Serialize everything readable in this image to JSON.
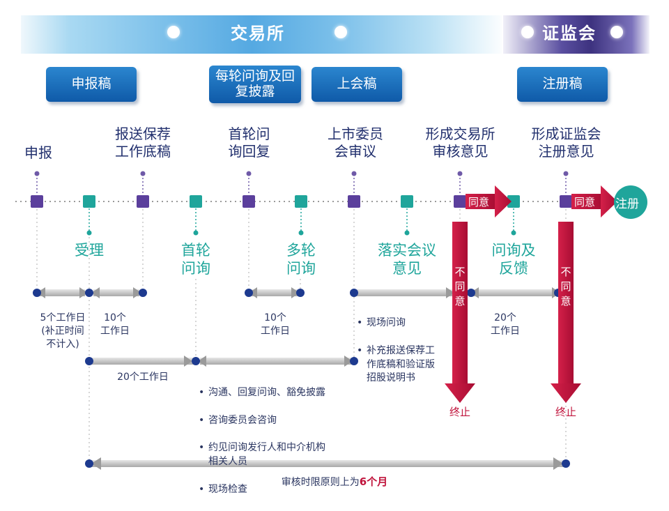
{
  "header": {
    "exchange": "交易所",
    "csrc": "证监会"
  },
  "docs": {
    "application": "申报稿",
    "inquiry_reply": "每轮问询及回复披露",
    "committee": "上会稿",
    "registration": "注册稿"
  },
  "stages_top": {
    "apply": "申报",
    "submit_work_papers": "报送保荐\n工作底稿",
    "first_reply": "首轮问\n询回复",
    "listing_committee": "上市委员\n会审议",
    "exchange_opinion": "形成交易所\n审核意见",
    "csrc_opinion": "形成证监会\n注册意见"
  },
  "stages_bottom": {
    "accept": "受理",
    "first_inquiry": "首轮\n问询",
    "multi_inquiry": "多轮\n问询",
    "implement_opinion": "落实会议\n意见",
    "inquiry_feedback": "问询及\n反馈"
  },
  "durations": {
    "d5": "5个工作日\n(补正时间\n不计入)",
    "d10a": "10个\n工作日",
    "d10b": "10个\n工作日",
    "d20a": "20个工作日",
    "d20b": "20个\n工作日"
  },
  "bullets_committee": [
    "现场问询",
    "补充报送保荐工\n作底稿和验证版\n招股说明书"
  ],
  "bullets_inquiry": [
    "沟通、回复问询、豁免披露",
    "咨询委员会咨询",
    "约见问询发行人和中介机构\n相关人员",
    "现场检查"
  ],
  "arrows": {
    "agree1": "同意",
    "agree2": "同意",
    "register": "注册",
    "disagree1": "不\n同\n意",
    "disagree2": "不\n同\n意",
    "terminate1": "终止",
    "terminate2": "终止"
  },
  "footer": {
    "text": "审核时限原则上为",
    "highlight": "6个月"
  },
  "colors": {
    "blue_box": "#1565b4",
    "purple": "#5b3f9c",
    "teal": "#1fa59b",
    "red": "#c0143c"
  }
}
